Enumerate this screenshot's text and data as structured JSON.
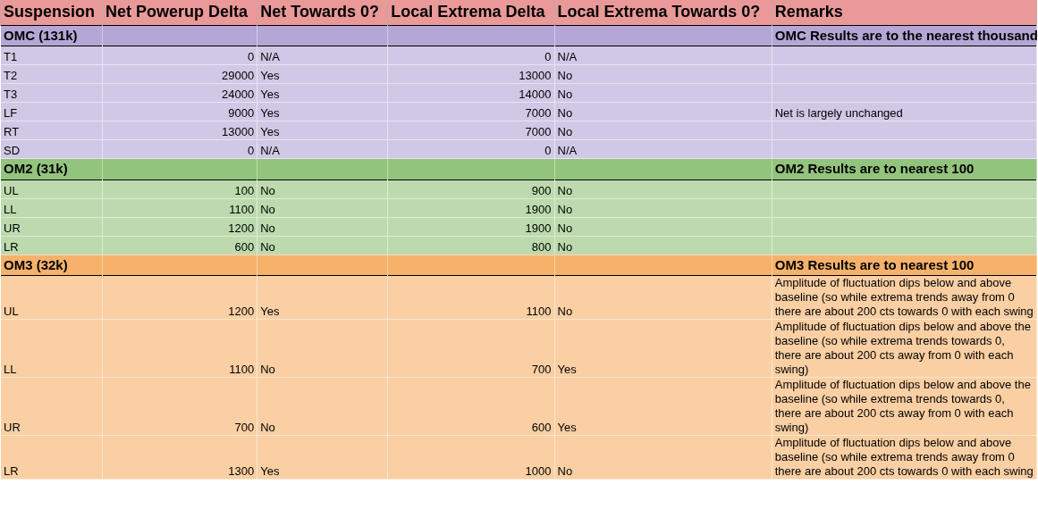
{
  "table": {
    "columns": [
      "Suspension",
      "Net Powerup Delta",
      "Net Towards 0?",
      "Local Extrema Delta",
      "Local Extrema Towards 0?",
      "Remarks"
    ],
    "groups": [
      {
        "label": "OMC (131k)",
        "remark": "OMC Results are to the nearest thousand",
        "color": "#b4a7d6",
        "rows": [
          [
            "T1",
            "0",
            "N/A",
            "0",
            "N/A",
            ""
          ],
          [
            "T2",
            "29000",
            "Yes",
            "13000",
            "No",
            ""
          ],
          [
            "T3",
            "24000",
            "Yes",
            "14000",
            "No",
            ""
          ],
          [
            "LF",
            "9000",
            "Yes",
            "7000",
            "No",
            "Net is largely unchanged"
          ],
          [
            "RT",
            "13000",
            "Yes",
            "7000",
            "No",
            ""
          ],
          [
            "SD",
            "0",
            "N/A",
            "0",
            "N/A",
            ""
          ]
        ]
      },
      {
        "label": "OM2 (31k)",
        "remark": "OM2 Results are to nearest 100",
        "color": "#93c47d",
        "rows": [
          [
            "UL",
            "100",
            "No",
            "900",
            "No",
            ""
          ],
          [
            "LL",
            "1100",
            "No",
            "1900",
            "No",
            ""
          ],
          [
            "UR",
            "1200",
            "No",
            "1900",
            "No",
            ""
          ],
          [
            "LR",
            "600",
            "No",
            "800",
            "No",
            ""
          ]
        ]
      },
      {
        "label": "OM3 (32k)",
        "remark": "OM3 Results are to nearest 100",
        "color": "#f6b26b",
        "rows": [
          [
            "UL",
            "1200",
            "Yes",
            "1100",
            "No",
            "Amplitude of fluctuation dips below and above baseline (so while extrema trends away from 0 there are about 200 cts towards 0 with each swing"
          ],
          [
            "LL",
            "1100",
            "No",
            "700",
            "Yes",
            "Amplitude of fluctuation dips below and above the baseline (so while extrema trends towards 0, there are about 200 cts away from 0 with each swing)"
          ],
          [
            "UR",
            "700",
            "No",
            "600",
            "Yes",
            "Amplitude of fluctuation dips below and above the baseline (so while extrema trends towards 0, there are about 200 cts away from 0 with each swing)"
          ],
          [
            "LR",
            "1300",
            "Yes",
            "1000",
            "No",
            "Amplitude of fluctuation dips below and above baseline (so while extrema trends away from 0 there are about 200 cts towards 0 with each swing"
          ]
        ]
      }
    ]
  }
}
